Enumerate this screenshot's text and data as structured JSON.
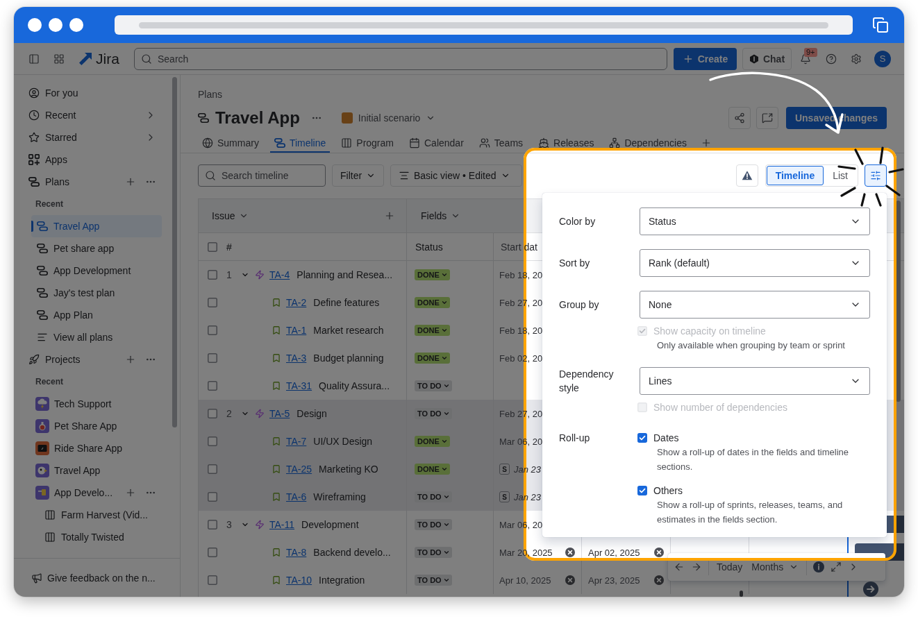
{
  "top_nav": {
    "product": "Jira",
    "search": {
      "placeholder": "Search"
    },
    "create": "Create",
    "chat": "Chat",
    "notifications": "9+",
    "avatar": "S"
  },
  "sidebar": {
    "items": [
      {
        "label": "For you",
        "selected": false,
        "submenu": false,
        "actions": false
      },
      {
        "label": "Recent",
        "selected": false,
        "submenu": true,
        "actions": false
      },
      {
        "label": "Starred",
        "selected": false,
        "submenu": true,
        "actions": false
      },
      {
        "label": "Apps",
        "selected": false,
        "submenu": false,
        "actions": false
      },
      {
        "label": "Plans",
        "selected": false,
        "submenu": false,
        "actions": true,
        "children": [
          {
            "kind": "heading",
            "label": "Recent"
          },
          {
            "kind": "plan",
            "label": "Travel App",
            "selected": true,
            "actions": false
          },
          {
            "kind": "plan",
            "label": "Pet share app",
            "selected": false,
            "actions": false
          },
          {
            "kind": "plan",
            "label": "App Development",
            "selected": false,
            "actions": false
          },
          {
            "kind": "plan",
            "label": "Jay's test plan",
            "selected": false,
            "actions": false
          },
          {
            "kind": "plan",
            "label": "App Plan",
            "selected": false,
            "actions": false
          },
          {
            "kind": "list",
            "label": "View all plans",
            "selected": false,
            "actions": false
          }
        ]
      },
      {
        "label": "Projects",
        "selected": false,
        "submenu": false,
        "actions": true,
        "children": [
          {
            "kind": "heading",
            "label": "Recent"
          },
          {
            "kind": "project",
            "label": "Tech Support",
            "selected": false,
            "actions": false
          },
          {
            "kind": "project",
            "label": "Pet Share App",
            "selected": false,
            "actions": false
          },
          {
            "kind": "project",
            "label": "Ride Share App",
            "selected": false,
            "actions": false
          },
          {
            "kind": "project",
            "label": "Travel App",
            "selected": false,
            "actions": false
          },
          {
            "kind": "project",
            "label": "App Develo...",
            "selected": false,
            "actions": true,
            "children": [
              {
                "kind": "board",
                "label": "Farm Harvest (Vid...",
                "selected": false,
                "actions": false
              },
              {
                "kind": "board",
                "label": "Totally Twisted",
                "selected": false,
                "actions": false
              }
            ]
          }
        ]
      }
    ],
    "feedback": "Give feedback on the n..."
  },
  "page": {
    "breadcrumb": "Plans",
    "title": "Travel App",
    "scenario": "Initial scenario",
    "primary_action": "Unsaved changes"
  },
  "tabs": [
    {
      "label": "Summary",
      "selected": false
    },
    {
      "label": "Timeline",
      "selected": true
    },
    {
      "label": "Program",
      "selected": false
    },
    {
      "label": "Calendar",
      "selected": false
    },
    {
      "label": "Teams",
      "selected": false
    },
    {
      "label": "Releases",
      "selected": false
    },
    {
      "label": "Dependencies",
      "selected": false
    }
  ],
  "toolbar": {
    "search": {
      "placeholder": "Search timeline"
    },
    "filter": "Filter",
    "view": "Basic view • Edited",
    "view_modes": [
      {
        "label": "Timeline",
        "selected": true
      },
      {
        "label": "List",
        "selected": false
      }
    ],
    "view_settings_open": true
  },
  "table": {
    "issue_heading": "Issue",
    "fields_heading": "Fields",
    "select_all": {
      "checked": false
    },
    "columns": [
      "#",
      "Status",
      "Start dat"
    ],
    "rows": [
      {
        "number": "1",
        "kind": "epic",
        "expanded": true,
        "checked": false,
        "highlighted": false,
        "key": "TA-4",
        "summary": "Planning and Resea...",
        "status": {
          "label": "DONE",
          "kind": "done"
        },
        "start": {
          "text": "Feb 18, 20"
        },
        "children": [
          {
            "kind": "story",
            "checked": false,
            "highlighted": false,
            "key": "TA-2",
            "summary": "Define features",
            "status": {
              "label": "DONE",
              "kind": "done"
            },
            "start": {
              "text": "Feb 27, 20"
            }
          },
          {
            "kind": "story",
            "checked": false,
            "highlighted": false,
            "key": "TA-1",
            "summary": "Market research",
            "status": {
              "label": "DONE",
              "kind": "done"
            },
            "start": {
              "text": "Feb 18, 20"
            }
          },
          {
            "kind": "story",
            "checked": false,
            "highlighted": false,
            "key": "TA-3",
            "summary": "Budget planning",
            "status": {
              "label": "DONE",
              "kind": "done"
            },
            "start": {
              "text": "Feb 02, 20"
            }
          },
          {
            "kind": "story",
            "checked": false,
            "highlighted": false,
            "key": "TA-31",
            "summary": "Quality Assura...",
            "status": {
              "label": "TO DO",
              "kind": "todo"
            }
          }
        ]
      },
      {
        "number": "2",
        "kind": "epic",
        "expanded": true,
        "checked": false,
        "highlighted": true,
        "key": "TA-5",
        "summary": "Design",
        "status": {
          "label": "TO DO",
          "kind": "todo"
        },
        "start": {
          "text": "Feb 27, 20"
        },
        "children": [
          {
            "kind": "story",
            "checked": false,
            "highlighted": true,
            "key": "TA-7",
            "summary": "UI/UX Design",
            "status": {
              "label": "DONE",
              "kind": "done"
            },
            "start": {
              "text": "Mar 06, 20"
            }
          },
          {
            "kind": "story",
            "checked": false,
            "highlighted": true,
            "key": "TA-25",
            "summary": "Marketing KO",
            "status": {
              "label": "DONE",
              "kind": "done"
            },
            "start": {
              "text": "Jan 23",
              "sprint": "S"
            }
          },
          {
            "kind": "story",
            "checked": false,
            "highlighted": true,
            "key": "TA-6",
            "summary": "Wireframing",
            "status": {
              "label": "TO DO",
              "kind": "todo"
            },
            "start": {
              "text": "Jan 23",
              "sprint": "S"
            }
          }
        ]
      },
      {
        "number": "3",
        "kind": "epic",
        "expanded": true,
        "checked": false,
        "highlighted": false,
        "key": "TA-11",
        "summary": "Development",
        "status": {
          "label": "TO DO",
          "kind": "todo"
        },
        "start": {
          "text": "Mar 06, 20"
        },
        "bar": true,
        "children": [
          {
            "kind": "story",
            "checked": false,
            "highlighted": false,
            "key": "TA-8",
            "summary": "Backend develo...",
            "status": {
              "label": "TO DO",
              "kind": "todo"
            },
            "start": {
              "text": "Mar 20, 2025",
              "clearable": true
            },
            "due": {
              "text": "Apr 02, 2025",
              "clearable": true
            },
            "bar": true
          },
          {
            "kind": "story",
            "checked": false,
            "highlighted": false,
            "key": "TA-10",
            "summary": "Integration",
            "status": {
              "label": "TO DO",
              "kind": "todo"
            },
            "start": {
              "text": "Apr 10, 2025",
              "clearable": true
            },
            "due": {
              "text": "Apr 23, 2025",
              "clearable": true
            },
            "bar": false
          }
        ]
      }
    ]
  },
  "view_settings": [
    {
      "kind": "select",
      "label": "Color by",
      "value": "Status"
    },
    {
      "kind": "select",
      "label": "Sort by",
      "value": "Rank (default)"
    },
    {
      "kind": "select",
      "label": "Group by",
      "value": "None"
    },
    {
      "kind": "checkbox",
      "text": "Show capacity on timeline",
      "checked": true,
      "disabled": true,
      "description": "Only available when grouping by team or sprint"
    },
    {
      "kind": "select",
      "label": "Dependency style",
      "value": "Lines"
    },
    {
      "kind": "checkbox",
      "text": "Show number of dependencies",
      "checked": false,
      "disabled": true
    },
    {
      "kind": "checkbox",
      "label": "Roll-up",
      "text": "Dates",
      "checked": true,
      "disabled": false,
      "description": "Show a roll-up of dates in the fields and timeline sections."
    },
    {
      "kind": "checkbox",
      "text": "Others",
      "checked": true,
      "disabled": false,
      "description": "Show a roll-up of sprints, releases, teams, and estimates in the fields section."
    }
  ],
  "timeline_nav": {
    "today": "Today",
    "scale": "Months"
  }
}
